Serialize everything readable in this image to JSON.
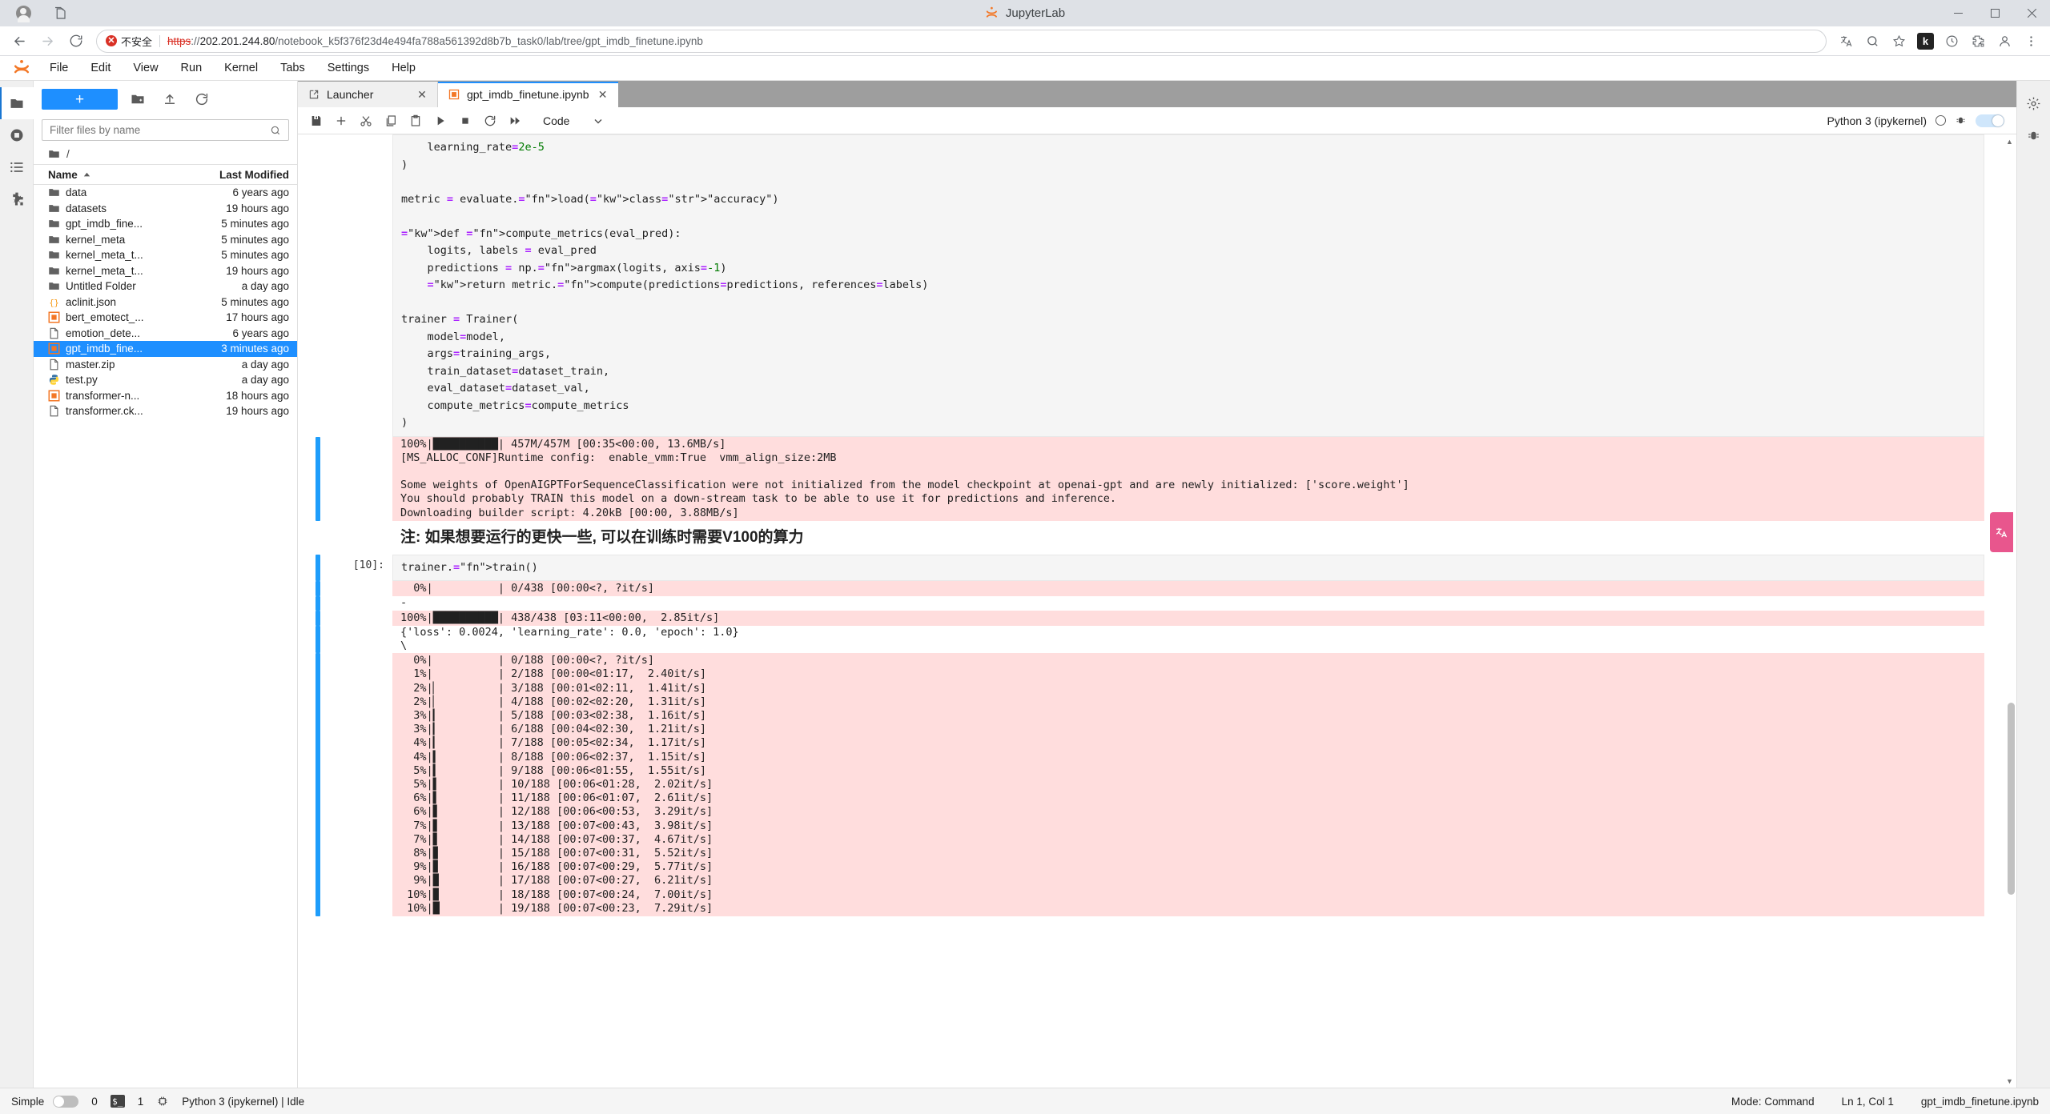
{
  "browser": {
    "page_title": "JupyterLab",
    "security_label": "不安全",
    "url_scheme": "https",
    "url_rest": "://202.201.244.80/notebook_k5f376f23d4e494fa788a561392d8b7b_task0/lab/tree/gpt_imdb_finetune.ipynb",
    "url_host": "202.201.244.80",
    "extension_badge": "k",
    "controls": {
      "minimize": "–",
      "maximize": "▢",
      "close": "✕"
    }
  },
  "jupyter": {
    "menu": [
      "File",
      "Edit",
      "View",
      "Run",
      "Kernel",
      "Tabs",
      "Settings",
      "Help"
    ],
    "filebrowser": {
      "new_button_label": "+",
      "filter_placeholder": "Filter files by name",
      "breadcrumb": "/",
      "columns": {
        "name": "Name",
        "modified": "Last Modified"
      },
      "items": [
        {
          "name": "data",
          "modified": "6 years ago",
          "icon": "folder",
          "selected": false
        },
        {
          "name": "datasets",
          "modified": "19 hours ago",
          "icon": "folder",
          "selected": false
        },
        {
          "name": "gpt_imdb_fine...",
          "modified": "5 minutes ago",
          "icon": "folder",
          "selected": false
        },
        {
          "name": "kernel_meta",
          "modified": "5 minutes ago",
          "icon": "folder",
          "selected": false
        },
        {
          "name": "kernel_meta_t...",
          "modified": "5 minutes ago",
          "icon": "folder",
          "selected": false
        },
        {
          "name": "kernel_meta_t...",
          "modified": "19 hours ago",
          "icon": "folder",
          "selected": false
        },
        {
          "name": "Untitled Folder",
          "modified": "a day ago",
          "icon": "folder",
          "selected": false
        },
        {
          "name": "aclinit.json",
          "modified": "5 minutes ago",
          "icon": "json",
          "selected": false
        },
        {
          "name": "bert_emotect_...",
          "modified": "17 hours ago",
          "icon": "notebook",
          "selected": false
        },
        {
          "name": "emotion_dete...",
          "modified": "6 years ago",
          "icon": "file",
          "selected": false
        },
        {
          "name": "gpt_imdb_fine...",
          "modified": "3 minutes ago",
          "icon": "notebook",
          "selected": true
        },
        {
          "name": "master.zip",
          "modified": "a day ago",
          "icon": "file",
          "selected": false
        },
        {
          "name": "test.py",
          "modified": "a day ago",
          "icon": "python",
          "selected": false
        },
        {
          "name": "transformer-n...",
          "modified": "18 hours ago",
          "icon": "notebook",
          "selected": false
        },
        {
          "name": "transformer.ck...",
          "modified": "19 hours ago",
          "icon": "file",
          "selected": false
        }
      ]
    },
    "tabs": [
      {
        "label": "Launcher",
        "icon": "launcher-icon",
        "active": false
      },
      {
        "label": "gpt_imdb_finetune.ipynb",
        "icon": "notebook-icon",
        "active": true
      }
    ],
    "notebook_toolbar": {
      "celltype": "Code",
      "kernel_name": "Python 3 (ipykernel)"
    },
    "statusbar": {
      "simple_label": "Simple",
      "terminals": "0",
      "kernels": "1",
      "kernel_status": "Python 3 (ipykernel) | Idle",
      "mode": "Mode: Command",
      "cursor": "Ln 1, Col 1",
      "filename": "gpt_imdb_finetune.ipynb"
    },
    "cells": [
      {
        "type": "code_partial",
        "prompt": "",
        "lines": [
          "    learning_rate=2e-5",
          ")",
          "",
          "metric = evaluate.load(\"accuracy\")",
          "",
          "def compute_metrics(eval_pred):",
          "    logits, labels = eval_pred",
          "    predictions = np.argmax(logits, axis=-1)",
          "    return metric.compute(predictions=predictions, references=labels)",
          "",
          "trainer = Trainer(",
          "    model=model,",
          "    args=training_args,",
          "    train_dataset=dataset_train,",
          "    eval_dataset=dataset_val,",
          "    compute_metrics=compute_metrics",
          ")"
        ]
      },
      {
        "type": "stderr",
        "lines": [
          "100%|██████████| 457M/457M [00:35<00:00, 13.6MB/s]",
          "[MS_ALLOC_CONF]Runtime config:  enable_vmm:True  vmm_align_size:2MB",
          "",
          "Some weights of OpenAIGPTForSequenceClassification were not initialized from the model checkpoint at openai-gpt and are newly initialized: ['score.weight']",
          "You should probably TRAIN this model on a down-stream task to be able to use it for predictions and inference.",
          "Downloading builder script: 4.20kB [00:00, 3.88MB/s]"
        ]
      },
      {
        "type": "markdown",
        "text": "注: 如果想要运行的更快一些, 可以在训练时需要V100的算力"
      },
      {
        "type": "code",
        "prompt": "[10]:",
        "lines": [
          "trainer.train()"
        ]
      },
      {
        "type": "stderr",
        "lines": [
          "  0%|          | 0/438 [00:00<?, ?it/s]"
        ]
      },
      {
        "type": "plain",
        "lines": [
          "-"
        ]
      },
      {
        "type": "stderr",
        "lines": [
          "100%|██████████| 438/438 [03:11<00:00,  2.85it/s]"
        ]
      },
      {
        "type": "plain",
        "lines": [
          "{'loss': 0.0024, 'learning_rate': 0.0, 'epoch': 1.0}",
          "\\"
        ]
      },
      {
        "type": "stderr_long",
        "lines": [
          "  0%|          | 0/188 [00:00<?, ?it/s]",
          "  1%|          | 2/188 [00:00<01:17,  2.40it/s]",
          "  2%|▏         | 3/188 [00:01<02:11,  1.41it/s]",
          "  2%|▏         | 4/188 [00:02<02:20,  1.31it/s]",
          "  3%|▎         | 5/188 [00:03<02:38,  1.16it/s]",
          "  3%|▎         | 6/188 [00:04<02:30,  1.21it/s]",
          "  4%|▎         | 7/188 [00:05<02:34,  1.17it/s]",
          "  4%|▍         | 8/188 [00:06<02:37,  1.15it/s]",
          "  5%|▍         | 9/188 [00:06<01:55,  1.55it/s]",
          "  5%|▌         | 10/188 [00:06<01:28,  2.02it/s]",
          "  6%|▌         | 11/188 [00:06<01:07,  2.61it/s]",
          "  6%|▋         | 12/188 [00:06<00:53,  3.29it/s]",
          "  7%|▋         | 13/188 [00:07<00:43,  3.98it/s]",
          "  7%|▋         | 14/188 [00:07<00:37,  4.67it/s]",
          "  8%|▊         | 15/188 [00:07<00:31,  5.52it/s]",
          "  9%|▊         | 16/188 [00:07<00:29,  5.77it/s]",
          "  9%|▉         | 17/188 [00:07<00:27,  6.21it/s]",
          " 10%|▉         | 18/188 [00:07<00:24,  7.00it/s]",
          " 10%|█         | 19/188 [00:07<00:23,  7.29it/s]"
        ]
      }
    ]
  }
}
